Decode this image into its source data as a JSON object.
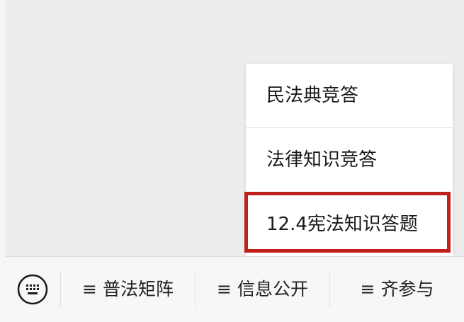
{
  "popup_menu": {
    "items": [
      {
        "label": "民法典竞答"
      },
      {
        "label": "法律知识竞答"
      },
      {
        "label": "12.4宪法知识答题"
      }
    ],
    "highlight_color": "#c0201c"
  },
  "bottom_menu": {
    "keyboard_icon": "keyboard-icon",
    "menu_glyph": "≡",
    "tabs": [
      {
        "label": "普法矩阵"
      },
      {
        "label": "信息公开"
      },
      {
        "label": "齐参与"
      }
    ]
  }
}
